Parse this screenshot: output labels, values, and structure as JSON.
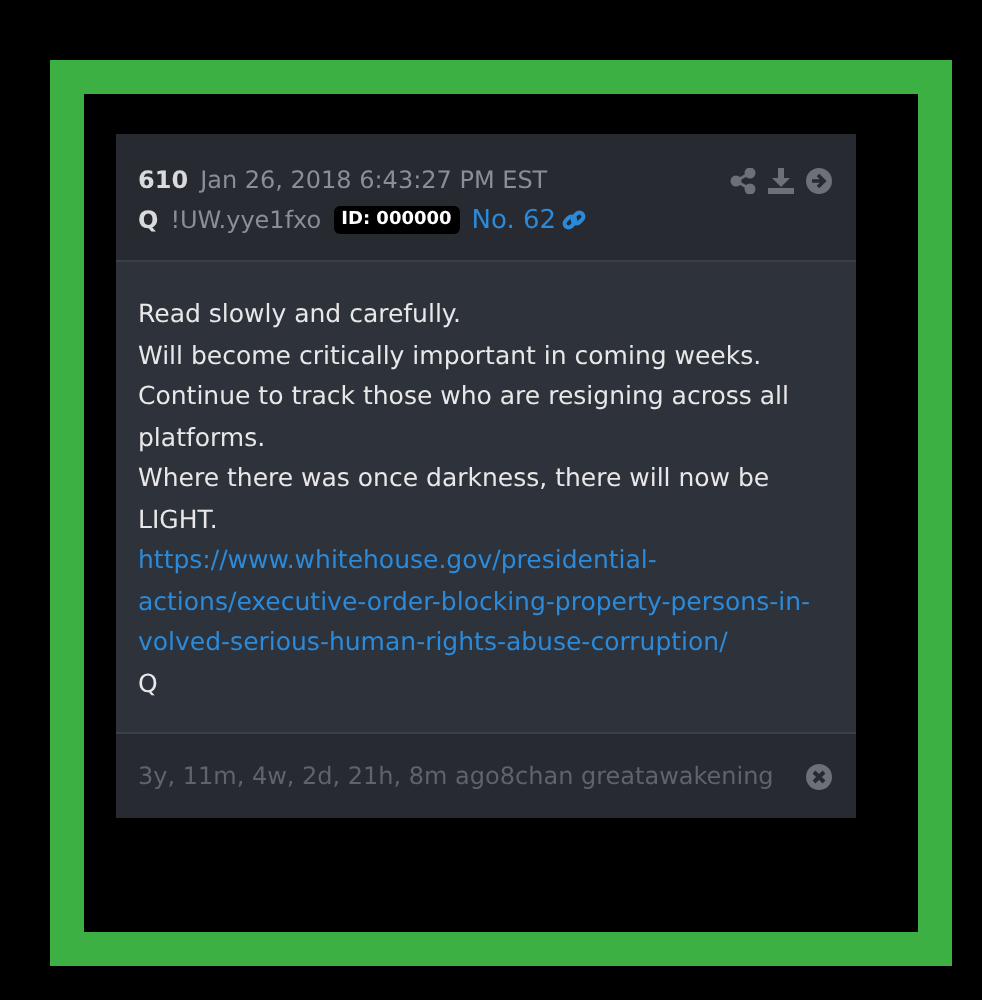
{
  "post": {
    "number": "610",
    "timestamp": "Jan 26, 2018 6:43:27 PM EST",
    "author": "Q",
    "tripcode": "!UW.yye1fxo",
    "id_badge": "ID: 000000",
    "post_no": "No. 62",
    "lines": [
      {
        "kind": "text",
        "text": "Read slowly and carefully."
      },
      {
        "kind": "text",
        "text": "Will become critically important in coming weeks."
      },
      {
        "kind": "text",
        "text": "Continue to track those who are resigning across all platforms."
      },
      {
        "kind": "text",
        "text": "Where there was once darkness, there will now be LIGHT."
      },
      {
        "kind": "link",
        "text": "https://www.whitehouse.gov/presidential-actions/executive-order-blocking-property-persons-in-volved-serious-human-rights-abuse-corruption/"
      },
      {
        "kind": "text",
        "text": "Q"
      }
    ],
    "age": "3y, 11m, 4w, 2d, 21h, 8m ago",
    "source": "8chan greatawakening"
  }
}
